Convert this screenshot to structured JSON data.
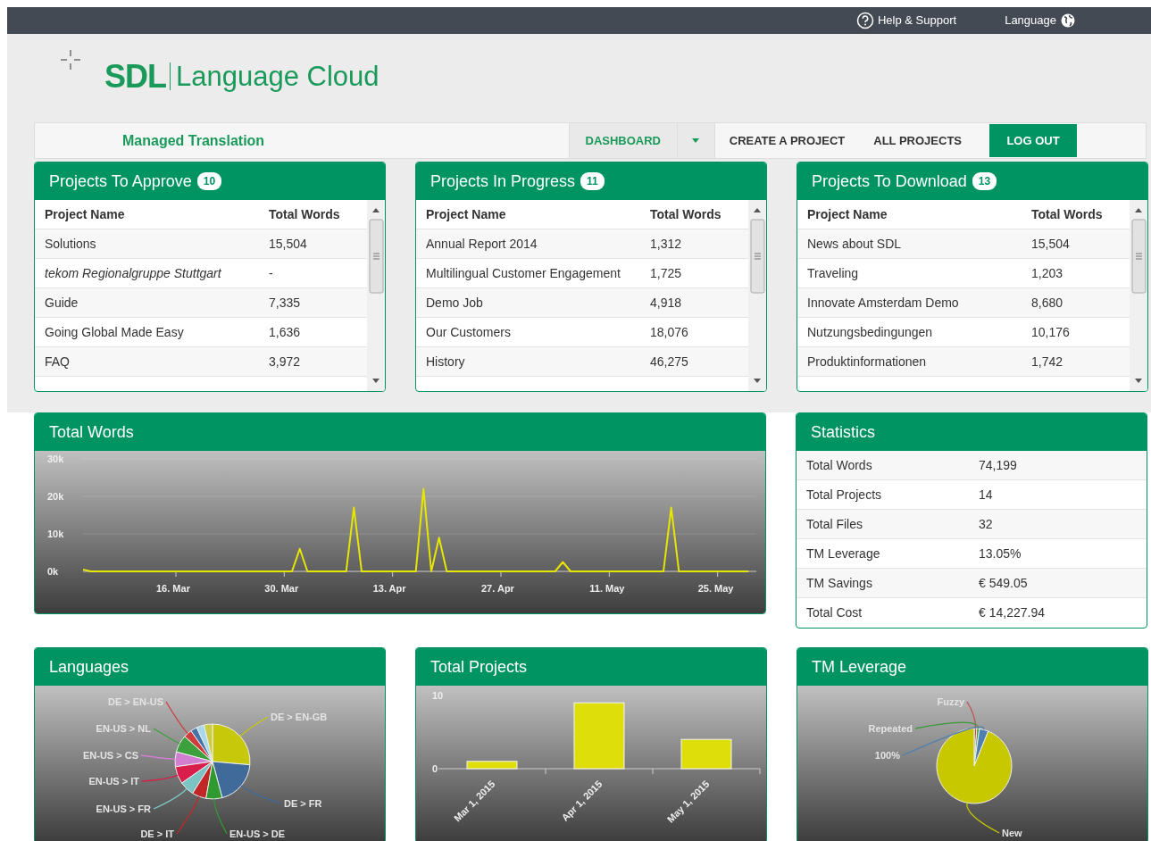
{
  "top_bar": {
    "help": "Help & Support",
    "language": "Language"
  },
  "logo": {
    "brand": "SDL",
    "product": "Language Cloud"
  },
  "nav": {
    "title": "Managed Translation",
    "tabs": [
      {
        "label": "DASHBOARD",
        "selected": true,
        "has_menu": true
      },
      {
        "label": "CREATE A PROJECT",
        "selected": false,
        "has_menu": false
      },
      {
        "label": "ALL PROJECTS",
        "selected": false,
        "has_menu": false
      }
    ],
    "logout": "LOG OUT"
  },
  "panels": [
    {
      "title": "Projects To Approve",
      "count": "10",
      "columns": [
        "Project Name",
        "Total Words"
      ],
      "rows": [
        {
          "name": "Solutions",
          "words": "15,504",
          "italic": false
        },
        {
          "name": "tekom Regionalgruppe Stuttgart",
          "words": "-",
          "italic": true
        },
        {
          "name": "Guide",
          "words": "7,335",
          "italic": false
        },
        {
          "name": "Going Global Made Easy",
          "words": "1,636",
          "italic": false
        },
        {
          "name": "FAQ",
          "words": "3,972",
          "italic": false
        }
      ]
    },
    {
      "title": "Projects In Progress",
      "count": "11",
      "columns": [
        "Project Name",
        "Total Words"
      ],
      "rows": [
        {
          "name": "Annual Report 2014",
          "words": "1,312",
          "italic": false
        },
        {
          "name": "Multilingual Customer Engagement",
          "words": "1,725",
          "italic": false
        },
        {
          "name": "Demo Job",
          "words": "4,918",
          "italic": false
        },
        {
          "name": "Our Customers",
          "words": "18,076",
          "italic": false
        },
        {
          "name": "History",
          "words": "46,275",
          "italic": false
        }
      ]
    },
    {
      "title": "Projects To Download",
      "count": "13",
      "columns": [
        "Project Name",
        "Total Words"
      ],
      "rows": [
        {
          "name": "News about SDL",
          "words": "15,504",
          "italic": false
        },
        {
          "name": "Traveling",
          "words": "1,203",
          "italic": false
        },
        {
          "name": "Innovate Amsterdam Demo",
          "words": "8,680",
          "italic": false
        },
        {
          "name": "Nutzungsbedingungen",
          "words": "10,176",
          "italic": false
        },
        {
          "name": "Produktinformationen",
          "words": "1,742",
          "italic": false
        }
      ]
    }
  ],
  "total_words": {
    "title": "Total Words",
    "chart_data": {
      "type": "line",
      "categories": [
        null,
        null,
        null,
        null,
        null,
        null,
        null,
        null,
        null,
        null,
        null,
        null,
        "16. Mar",
        null,
        null,
        null,
        null,
        null,
        null,
        null,
        null,
        null,
        null,
        null,
        null,
        null,
        "30. Mar",
        null,
        null,
        null,
        null,
        null,
        null,
        null,
        null,
        null,
        null,
        null,
        null,
        null,
        "13. Apr",
        null,
        null,
        null,
        null,
        null,
        null,
        null,
        null,
        null,
        null,
        null,
        null,
        null,
        "27. Apr",
        null,
        null,
        null,
        null,
        null,
        null,
        null,
        null,
        null,
        null,
        null,
        null,
        null,
        "11. May",
        null,
        null,
        null,
        null,
        null,
        null,
        null,
        null,
        null,
        null,
        null,
        null,
        null,
        "25. May",
        null,
        null,
        null,
        null
      ],
      "values": [
        500,
        0,
        0,
        0,
        0,
        0,
        0,
        0,
        0,
        0,
        0,
        0,
        0,
        0,
        0,
        0,
        0,
        0,
        0,
        0,
        0,
        0,
        0,
        0,
        0,
        0,
        0,
        0,
        6000,
        0,
        0,
        0,
        0,
        0,
        0,
        17000,
        0,
        0,
        0,
        0,
        0,
        0,
        0,
        0,
        22000,
        0,
        9000,
        0,
        0,
        0,
        0,
        0,
        0,
        0,
        0,
        0,
        0,
        0,
        0,
        0,
        0,
        0,
        2500,
        0,
        0,
        0,
        0,
        0,
        0,
        0,
        0,
        0,
        0,
        0,
        0,
        0,
        17000,
        0,
        0,
        0,
        0,
        0,
        0,
        0,
        0,
        0,
        0
      ],
      "ylim": [
        0,
        30000
      ],
      "yticks": [
        {
          "value": 0,
          "label": "0k"
        },
        {
          "value": 10000,
          "label": "10k"
        },
        {
          "value": 20000,
          "label": "20k"
        },
        {
          "value": 30000,
          "label": "30k"
        }
      ]
    }
  },
  "statistics": {
    "title": "Statistics",
    "rows": [
      {
        "label": "Total Words",
        "value": "74,199"
      },
      {
        "label": "Total Projects",
        "value": "14"
      },
      {
        "label": "Total Files",
        "value": "32"
      },
      {
        "label": "TM Leverage",
        "value": "13.05%"
      },
      {
        "label": "TM Savings",
        "value": "€ 549.05"
      },
      {
        "label": "Total Cost",
        "value": "€ 14,227.94"
      }
    ]
  },
  "languages": {
    "title": "Languages",
    "slices": [
      {
        "label": "DE > EN-US",
        "color": "#d03c3c"
      },
      {
        "label": "DE > EN-GB",
        "color": "#c8c80a"
      },
      {
        "label": "EN-US > NL",
        "color": "#3ca03c"
      },
      {
        "label": "EN-US > CS",
        "color": "#d27fd2"
      },
      {
        "label": "EN-US > IT",
        "color": "#d81e4a"
      },
      {
        "label": "DE > FR",
        "color": "#3f6a9a"
      },
      {
        "label": "EN-US > FR",
        "color": "#7cc4c4"
      },
      {
        "label": "DE > IT",
        "color": "#c02828"
      },
      {
        "label": "EN-US > DE",
        "color": "#2f9a2f"
      }
    ]
  },
  "total_projects": {
    "title": "Total Projects",
    "chart_data": {
      "type": "bar",
      "categories": [
        "Mar 1, 2015",
        "Apr 1, 2015",
        "May 1, 2015"
      ],
      "values": [
        1,
        9,
        4
      ],
      "ylim": [
        0,
        10
      ],
      "yticks": [
        0,
        10
      ]
    }
  },
  "tm_leverage": {
    "title": "TM Leverage",
    "slices": [
      {
        "label": "Fuzzy",
        "color": "#c05050"
      },
      {
        "label": "Repeated",
        "color": "#3a9a3a"
      },
      {
        "label": "100%",
        "color": "#4f7fb0"
      },
      {
        "label": "New",
        "color": "#c8c800"
      }
    ]
  }
}
